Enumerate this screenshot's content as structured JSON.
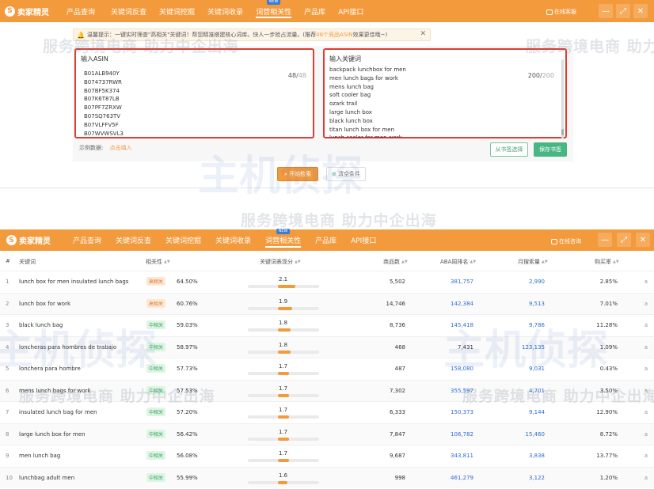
{
  "app": {
    "logo_text": "卖家精灵",
    "nav": [
      "产品查询",
      "关键词反查",
      "关键词挖掘",
      "关键词收录",
      "词营相关性",
      "产品库",
      "API接口"
    ],
    "nav2": [
      "产品查询",
      "关键词反查",
      "关键词挖掘",
      "关键词收录",
      "词营相关性",
      "产品库",
      "API接口"
    ],
    "new_badge": "NEW",
    "online_service": "在线客服",
    "online_service2": "在线咨询"
  },
  "tip": {
    "text_before": "温馨提示：一键实时筛查\"高相关\"关键词！帮您精准搭建核心词库。快人一步抢占流量。(推荐",
    "highlight": "48个竞品ASIN",
    "text_after": "效果更佳哦~)"
  },
  "asin_box": {
    "title": "输入ASIN",
    "count": "48",
    "max": "48",
    "items": [
      "B01ALB940Y",
      "B074737RWR",
      "B07BF5K374",
      "B07K6T87LB",
      "B07PF7ZRXW",
      "B07SQ763TV",
      "B07VLFFV5F",
      "B07WVWSVL3"
    ]
  },
  "keyword_box": {
    "title": "输入关键词",
    "count": "200",
    "max": "200",
    "items": [
      "backpack lunchbox for men",
      "men lunch bags for work",
      "mens lunch bag",
      "soft cooler bag",
      "ozark trail",
      "large lunch box",
      "black lunch box",
      "titan lunch box for men",
      "lunch cooler for men work"
    ]
  },
  "example": {
    "label": "示例数据:",
    "link": "点击填入"
  },
  "buttons": {
    "from_favorites": "从书签选择",
    "save_favorite": "保存书签",
    "start": "开始检索",
    "clear": "清空条件"
  },
  "table": {
    "headers": {
      "idx": "#",
      "keyword": "关键词",
      "relevance": "相关性",
      "score": "关键词表现分",
      "products": "商品数",
      "aba": "ABA周排名",
      "search": "月搜索量",
      "buy": "购买率"
    },
    "rows": [
      {
        "idx": "1",
        "keyword": "lunch box for men insulated lunch bags",
        "level": "高相关",
        "pct": "64.50%",
        "score": "2.1",
        "products": "5,502",
        "aba": "381,757",
        "search": "2,990",
        "buy": "2.85%",
        "a": "a"
      },
      {
        "idx": "2",
        "keyword": "lunch box for work",
        "level": "高相关",
        "pct": "60.76%",
        "score": "1.9",
        "products": "14,746",
        "aba": "142,384",
        "search": "9,513",
        "buy": "7.01%",
        "a": "a"
      },
      {
        "idx": "3",
        "keyword": "black lunch bag",
        "level": "中相关",
        "pct": "59.03%",
        "score": "1.8",
        "products": "8,736",
        "aba": "145,418",
        "search": "9,786",
        "buy": "11.28%",
        "a": "a"
      },
      {
        "idx": "4",
        "keyword": "loncheras para hombres de trabajo",
        "level": "中相关",
        "pct": "58.97%",
        "score": "1.8",
        "products": "468",
        "aba": "7,431",
        "search": "123,135",
        "buy": "1.09%",
        "a": "a"
      },
      {
        "idx": "5",
        "keyword": "lonchera para hombre",
        "level": "中相关",
        "pct": "57.73%",
        "score": "1.7",
        "products": "487",
        "aba": "158,080",
        "search": "9,031",
        "buy": "0.43%",
        "a": "a"
      },
      {
        "idx": "6",
        "keyword": "mens lunch bags for work",
        "level": "中相关",
        "pct": "57.53%",
        "score": "1.7",
        "products": "7,302",
        "aba": "355,597",
        "search": "4,701",
        "buy": "3.50%",
        "a": "a"
      },
      {
        "idx": "7",
        "keyword": "insulated lunch bag for men",
        "level": "中相关",
        "pct": "57.20%",
        "score": "1.7",
        "products": "6,333",
        "aba": "150,373",
        "search": "9,144",
        "buy": "12.90%",
        "a": "a"
      },
      {
        "idx": "8",
        "keyword": "large lunch box for men",
        "level": "中相关",
        "pct": "56.42%",
        "score": "1.7",
        "products": "7,847",
        "aba": "106,782",
        "search": "15,460",
        "buy": "8.72%",
        "a": "a"
      },
      {
        "idx": "9",
        "keyword": "men lunch bag",
        "level": "中相关",
        "pct": "56.08%",
        "score": "1.7",
        "products": "9,687",
        "aba": "343,811",
        "search": "3,838",
        "buy": "13.77%",
        "a": "a"
      },
      {
        "idx": "10",
        "keyword": "lunchbag adult men",
        "level": "中相关",
        "pct": "55.99%",
        "score": "1.6",
        "products": "998",
        "aba": "461,279",
        "search": "3,122",
        "buy": "1.20%",
        "a": "a"
      }
    ]
  },
  "watermarks": {
    "brand": "主机侦探",
    "slogan": "服务跨境电商 助力中企出海"
  },
  "colors": {
    "brand_orange": "#f39a3c",
    "link_blue": "#2f6bd1",
    "border_red": "#e03c31",
    "green": "#48b683"
  }
}
